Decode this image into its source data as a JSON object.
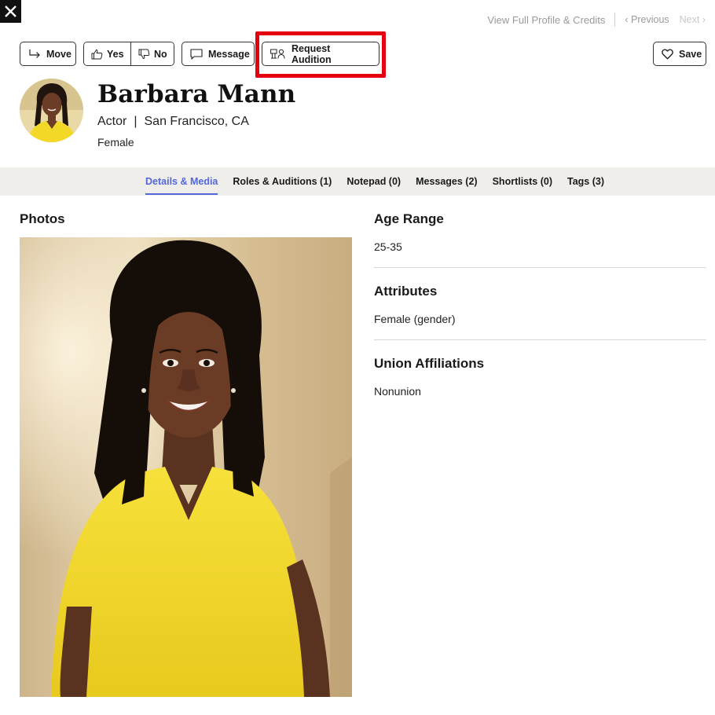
{
  "topnav": {
    "full_profile": "View Full Profile & Credits",
    "previous": "‹ Previous",
    "next": "Next ›"
  },
  "toolbar": {
    "move": "Move",
    "yes": "Yes",
    "no": "No",
    "message": "Message",
    "request_audition": "Request Audition",
    "save": "Save"
  },
  "profile": {
    "name": "Barbara Mann",
    "role": "Actor",
    "location": "San Francisco, CA",
    "gender": "Female"
  },
  "tabs": [
    {
      "label": "Details & Media",
      "active": true
    },
    {
      "label": "Roles & Auditions (1)",
      "active": false
    },
    {
      "label": "Notepad (0)",
      "active": false
    },
    {
      "label": "Messages (2)",
      "active": false
    },
    {
      "label": "Shortlists (0)",
      "active": false
    },
    {
      "label": "Tags (3)",
      "active": false
    }
  ],
  "photos": {
    "title": "Photos"
  },
  "details": {
    "age_range": {
      "title": "Age Range",
      "value": "25-35"
    },
    "attributes": {
      "title": "Attributes",
      "value": "Female (gender)"
    },
    "union": {
      "title": "Union Affiliations",
      "value": "Nonunion"
    }
  },
  "colors": {
    "accent": "#5367d6",
    "highlight": "#e4000f",
    "tabbar_bg": "#f0eeea"
  }
}
